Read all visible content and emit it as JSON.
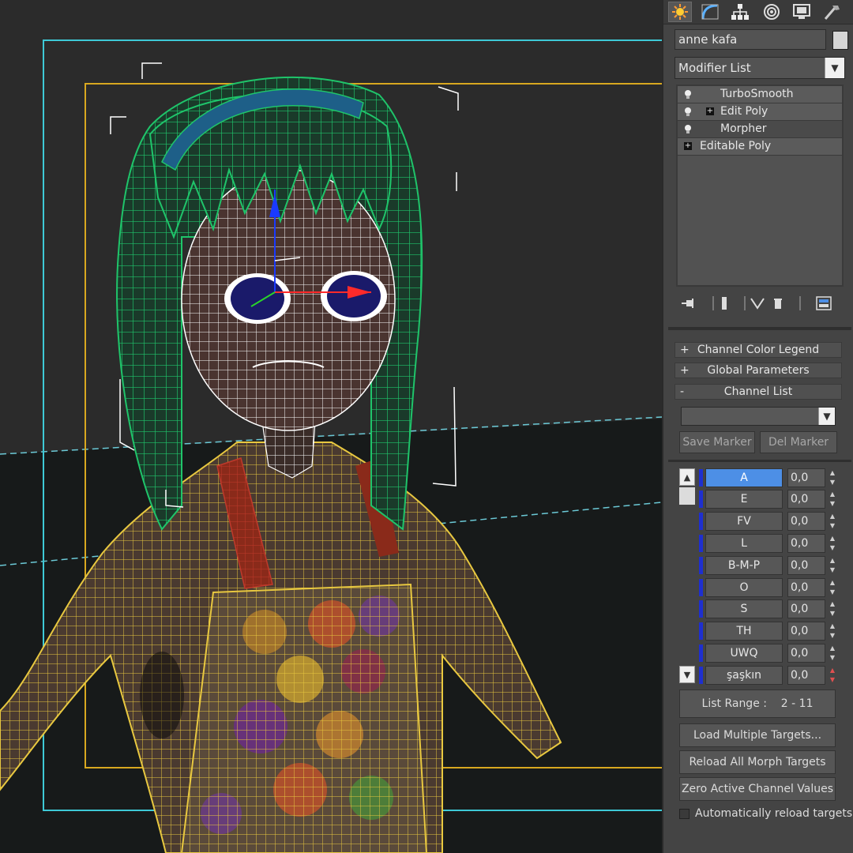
{
  "command_panel": {
    "tabs": [
      {
        "icon": "create-icon",
        "active": true
      },
      {
        "icon": "modify-icon"
      },
      {
        "icon": "hierarchy-icon"
      },
      {
        "icon": "motion-icon"
      },
      {
        "icon": "display-icon"
      },
      {
        "icon": "utilities-icon"
      }
    ],
    "object_name": "anne kafa",
    "modifier_list_label": "Modifier List",
    "stack": [
      {
        "label": "TurboSmooth",
        "bulb": true,
        "expand": false
      },
      {
        "label": "Edit Poly",
        "bulb": true,
        "expand": true
      },
      {
        "label": "Morpher",
        "bulb": true,
        "expand": false
      },
      {
        "label": "Editable Poly",
        "bulb": false,
        "expand": true
      }
    ],
    "stack_tools": [
      "pin-stack-icon",
      "show-end-result-icon",
      "make-unique-icon",
      "remove-modifier-icon",
      "configure-sets-icon"
    ]
  },
  "morpher": {
    "rollouts": [
      {
        "sign": "+",
        "label": "Channel Color Legend"
      },
      {
        "sign": "+",
        "label": "Global Parameters"
      },
      {
        "sign": "-",
        "label": "Channel List"
      }
    ],
    "marker_dropdown_value": "",
    "save_marker_label": "Save Marker",
    "del_marker_label": "Del Marker",
    "channel_color": "#1e2fd0",
    "selected_color": "#4d8fe6",
    "channels": [
      {
        "name": "A",
        "value": "0,0",
        "selected": true
      },
      {
        "name": "E",
        "value": "0,0"
      },
      {
        "name": "FV",
        "value": "0,0"
      },
      {
        "name": "L",
        "value": "0,0"
      },
      {
        "name": "B-M-P",
        "value": "0,0"
      },
      {
        "name": "O",
        "value": "0,0"
      },
      {
        "name": "S",
        "value": "0,0"
      },
      {
        "name": "TH",
        "value": "0,0"
      },
      {
        "name": "UWQ",
        "value": "0,0"
      },
      {
        "name": "şaşkın",
        "value": "0,0"
      }
    ],
    "list_range_label": "List Range :",
    "list_range_value": "2 - 11",
    "load_multiple_label": "Load Multiple Targets...",
    "reload_all_label": "Reload All Morph Targets",
    "zero_active_label": "Zero Active Channel Values",
    "auto_reload_label": "Automatically reload targets",
    "auto_reload_checked": false
  },
  "viewport": {
    "wire_colors": {
      "hair": "#1fc46a",
      "face": "#ffffff",
      "body": "#e8c840",
      "apron_straps": "#b83a1a",
      "headband": "#1e7fa8",
      "selection_box": "#ffffff",
      "frame_cyan": "#3ec9d6",
      "frame_yellow": "#d8a820"
    }
  }
}
